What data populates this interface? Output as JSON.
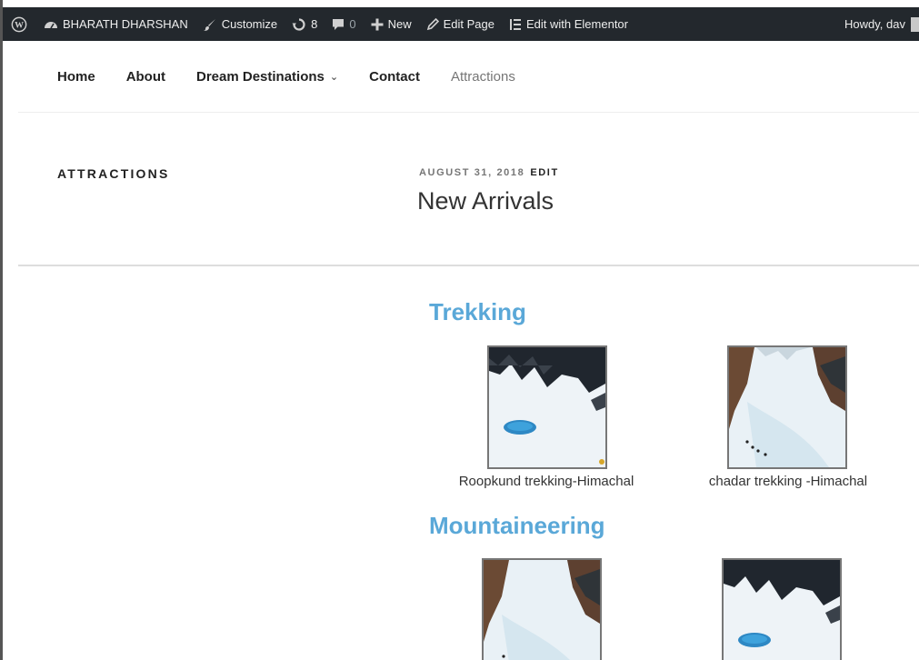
{
  "admin_bar": {
    "site_name": "BHARATH DHARSHAN",
    "customize": "Customize",
    "updates_count": "8",
    "comments_count": "0",
    "new": "New",
    "edit_page": "Edit Page",
    "edit_elementor": "Edit with Elementor",
    "howdy": "Howdy, dav"
  },
  "nav": {
    "items": [
      {
        "label": "Home"
      },
      {
        "label": "About"
      },
      {
        "label": "Dream Destinations"
      },
      {
        "label": "Contact"
      },
      {
        "label": "Attractions"
      }
    ]
  },
  "page": {
    "title": "ATTRACTIONS",
    "date": "AUGUST 31, 2018",
    "edit": "EDIT",
    "entry_title": "New Arrivals"
  },
  "sections": [
    {
      "heading": "Trekking",
      "items": [
        {
          "caption": "Roopkund trekking-Himachal"
        },
        {
          "caption": "chadar trekking -Himachal"
        }
      ]
    },
    {
      "heading": "Mountaineering"
    }
  ],
  "colors": {
    "admin_bar_bg": "#23282d",
    "section_heading": "#5aa8d8",
    "nav_current": "#767676"
  }
}
